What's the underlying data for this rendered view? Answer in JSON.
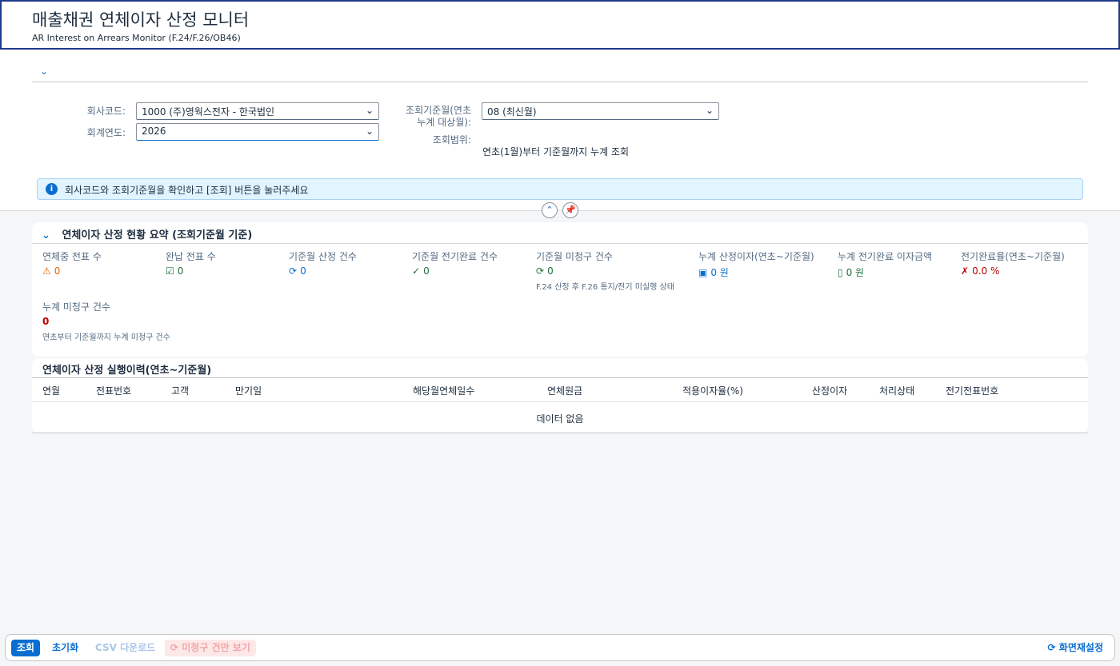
{
  "header": {
    "title": "매출채권 연체이자 산정 모니터",
    "subtitle": "AR Interest on Arrears Monitor (F.24/F.26/OB46)"
  },
  "filter": {
    "company_label": "회사코드:",
    "company_value": "1000 (주)영웍스전자 - 한국법인",
    "year_label": "회계연도:",
    "year_value": "2026",
    "period_label": "조회기준월(연초 누계 대상월):",
    "period_value": "08 (최신월)",
    "range_label": "조회범위:",
    "range_value": "연초(1월)부터 기준월까지 누계 조회"
  },
  "message": {
    "text": "회사코드와 조회기준월을 확인하고 [조회] 버튼을 눌러주세요"
  },
  "summary": {
    "title": "연체이자 산정 현황 요약 (조회기준월 기준)",
    "kpis": [
      {
        "label": "연체중 전표 수",
        "value": "0",
        "color": "#e76500",
        "icon": "🗎",
        "icon_name": "overdue-doc-icon"
      },
      {
        "label": "완납 전표 수",
        "value": "0",
        "color": "#256f3a",
        "icon": "☑",
        "icon_name": "paid-check-icon"
      },
      {
        "label": "기준월 산정 건수",
        "value": "0",
        "color": "#0a6ed1",
        "icon": "⟳",
        "icon_name": "refresh-icon"
      },
      {
        "label": "기준월 전기완료 건수",
        "value": "0",
        "color": "#256f3a",
        "icon": "✓",
        "icon_name": "check-icon"
      },
      {
        "label": "기준월 미청구 건수",
        "value": "0",
        "color": "#256f3a",
        "icon": "⟳",
        "icon_name": "pending-icon",
        "note": "F.24 산정 후 F.26 통지/전기 미실행 상태"
      },
      {
        "label": "누계 산정이자(연초~기준월)",
        "value": "0 원",
        "color": "#0a6ed1",
        "icon": "▣",
        "icon_name": "money-icon"
      },
      {
        "label": "누계 전기완료 이자금액",
        "value": "0 원",
        "color": "#256f3a",
        "icon": "▯",
        "icon_name": "clipboard-icon"
      },
      {
        "label": "전기완료율(연초~기준월)",
        "value": "0.0 %",
        "color": "#bb0000",
        "icon": "✗",
        "icon_name": "rate-icon"
      }
    ],
    "cumulative": {
      "label": "누계 미청구 건수",
      "value": "0",
      "note": "연초부터 기준월까지 누계 미청구 건수"
    }
  },
  "history": {
    "title": "연체이자 산정 실행이력(연초~기준월)",
    "columns": [
      "연월",
      "전표번호",
      "고객",
      "만기일",
      "해당월연체일수",
      "연체원금",
      "적용이자율(%)",
      "산정이자",
      "처리상태",
      "전기전표번호"
    ],
    "empty_text": "데이터 없음"
  },
  "footer": {
    "search": "조회",
    "reset": "초기화",
    "csv": "CSV 다운로드",
    "unbilled": "미청구 건만 보기",
    "reset_view": "화면재설정"
  }
}
